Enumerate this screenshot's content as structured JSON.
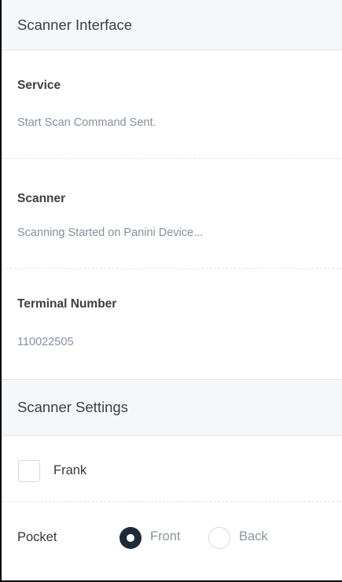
{
  "scanner_interface": {
    "title": "Scanner Interface",
    "service": {
      "label": "Service",
      "value": "Start Scan Command Sent."
    },
    "scanner": {
      "label": "Scanner",
      "value": "Scanning Started on Panini Device..."
    },
    "terminal": {
      "label": "Terminal Number",
      "value": "110022505"
    }
  },
  "scanner_settings": {
    "title": "Scanner Settings",
    "frank": {
      "label": "Frank",
      "checked": false
    },
    "pocket": {
      "label": "Pocket",
      "options": [
        "Front",
        "Back"
      ],
      "selected": "Front"
    }
  },
  "colors": {
    "header_bg": "#f5f7fa",
    "radio_selected": "#1f2a38",
    "value_text": "#8391a0"
  }
}
